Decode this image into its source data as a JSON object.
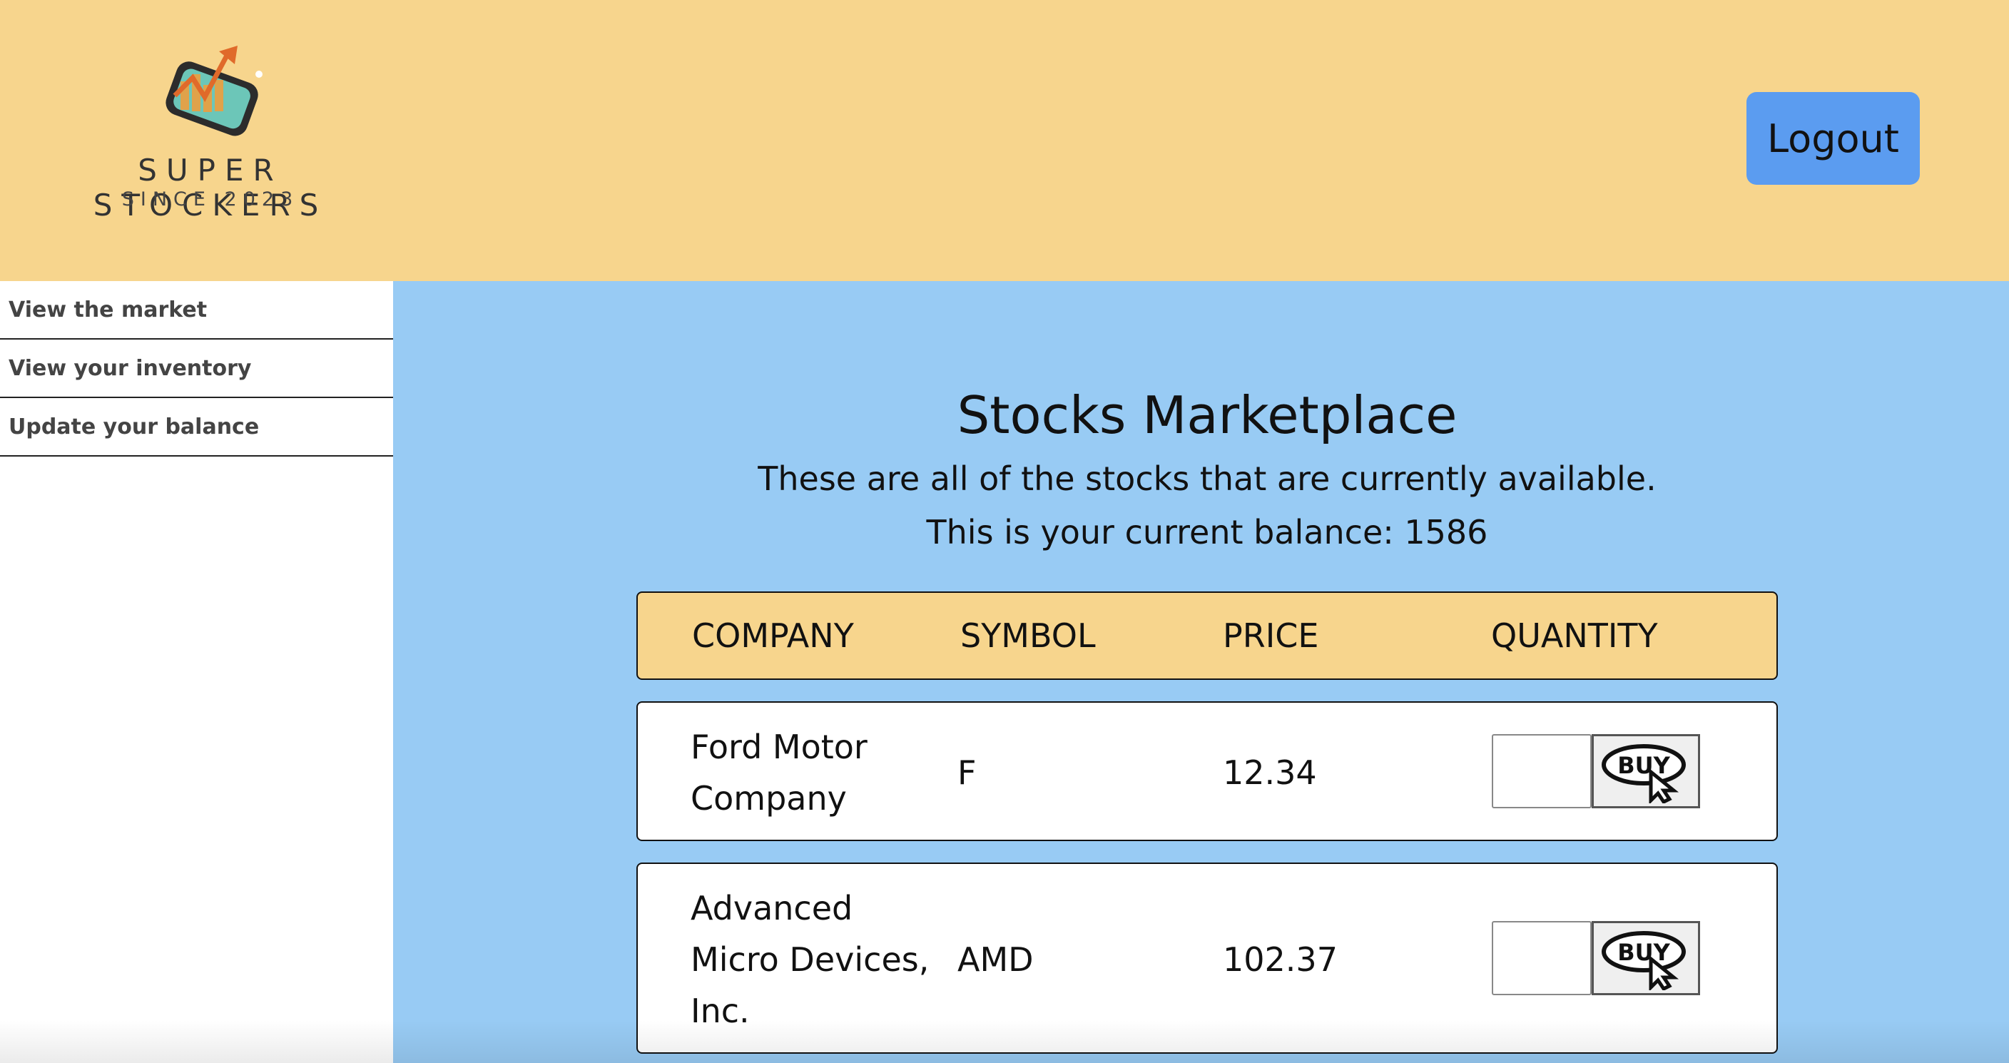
{
  "brand": {
    "name": "SUPER STOCKERS",
    "since": "SINCE 2023"
  },
  "header": {
    "logout_label": "Logout"
  },
  "sidebar": {
    "items": [
      {
        "label": "View the market"
      },
      {
        "label": "View your inventory"
      },
      {
        "label": "Update your balance"
      }
    ]
  },
  "main": {
    "title": "Stocks Marketplace",
    "subtitle": "These are all of the stocks that are currently available.",
    "balance_text": "This is your current balance: 1586"
  },
  "table": {
    "headers": [
      "COMPANY",
      "SYMBOL",
      "PRICE",
      "QUANTITY"
    ],
    "rows": [
      {
        "company_lines": [
          "Ford Motor",
          "Company"
        ],
        "symbol": "F",
        "price": "12.34",
        "buy_label": "BUY"
      },
      {
        "company_lines": [
          "Advanced",
          "Micro Devices,",
          "Inc."
        ],
        "symbol": "AMD",
        "price": "102.37",
        "buy_label": "BUY"
      }
    ]
  },
  "colors": {
    "header_bg": "#f7d58d",
    "main_bg": "#98cbf4",
    "logout_bg": "#5b9cf0"
  },
  "icons": [
    "stock-chart-logo-icon",
    "buy-cursor-icon"
  ]
}
